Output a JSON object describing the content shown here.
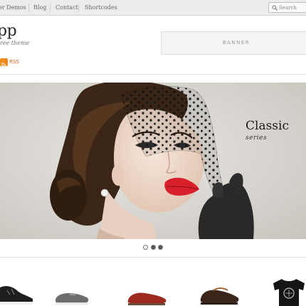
{
  "topbar": {
    "nav_items": [
      "er Demos",
      "Blog",
      "Contact",
      "Shortcodes"
    ],
    "search": {
      "placeholder": "Search"
    }
  },
  "header": {
    "site_title": "pp",
    "tagline": "ree theme",
    "rss_label": "RSS",
    "banner_label": "BANNER"
  },
  "slider": {
    "caption_title": "Classic",
    "caption_subtitle": "series",
    "dot_count": 3,
    "active_dot": 2
  },
  "products": {
    "items": [
      {
        "icon": "black-sneaker-icon"
      },
      {
        "icon": "gray-sneaker-icon"
      },
      {
        "icon": "red-loafer-icon"
      },
      {
        "icon": "brown-brogue-icon"
      },
      {
        "icon": "black-tshirt-icon"
      }
    ]
  },
  "colors": {
    "rss": "#f08b1b",
    "lips": "#d8202c",
    "background": "#ffffff"
  }
}
